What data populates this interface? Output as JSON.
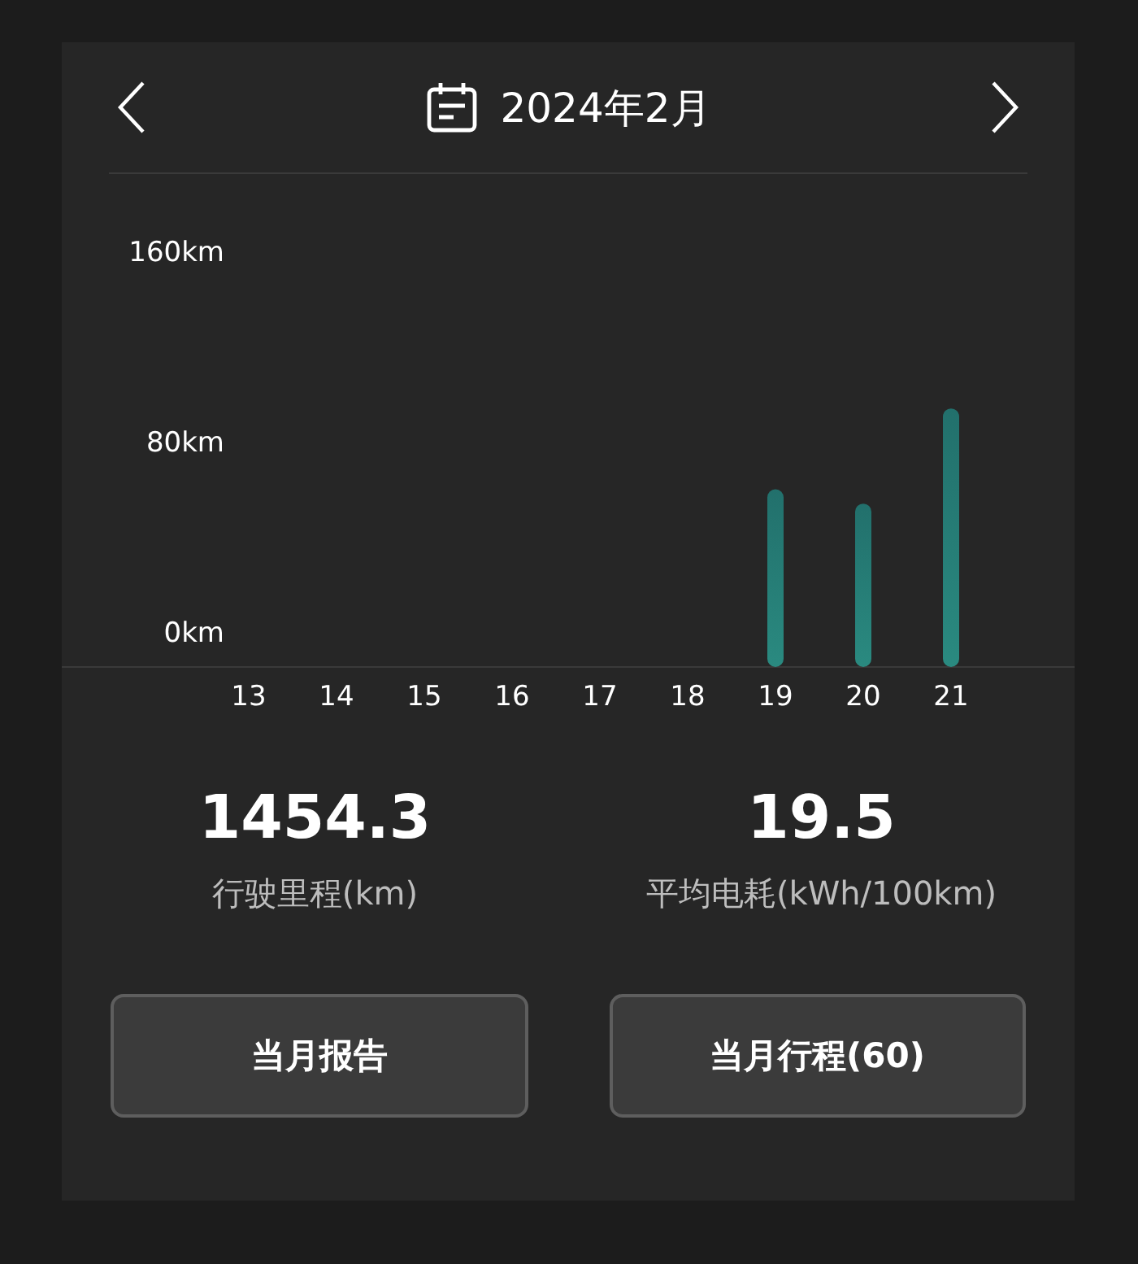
{
  "header": {
    "title": "2024年2月"
  },
  "chart": {
    "chart_data": {
      "type": "bar",
      "categories": [
        "13",
        "14",
        "15",
        "16",
        "17",
        "18",
        "19",
        "20",
        "21"
      ],
      "series": [
        {
          "color": "#2a8a80",
          "values": [
            0,
            0,
            0,
            0,
            0,
            0,
            61,
            55,
            95
          ]
        }
      ],
      "ylim": [
        0,
        160
      ],
      "yticks": [
        {
          "value": 0,
          "label": "0km"
        },
        {
          "value": 80,
          "label": "80km"
        },
        {
          "value": 160,
          "label": "160km"
        }
      ]
    }
  },
  "stats": [
    {
      "value": "1454.3",
      "label": "行驶里程(km)"
    },
    {
      "value": "19.5",
      "label": "平均电耗(kWh/100km)"
    }
  ],
  "buttons": [
    "当月报告",
    "当月行程(60)"
  ]
}
